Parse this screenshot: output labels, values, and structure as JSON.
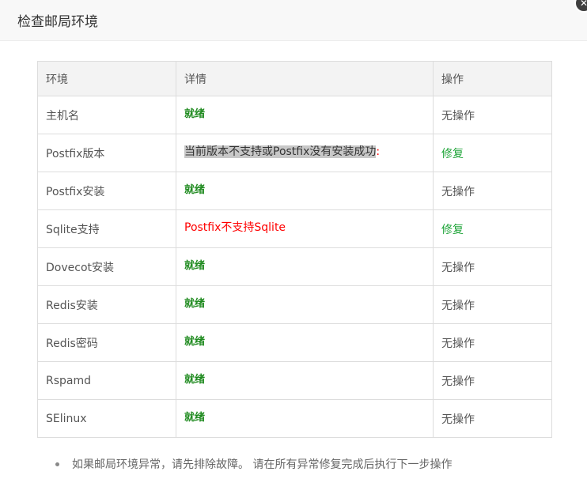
{
  "dialog": {
    "title": "检查邮局环境",
    "close_symbol": "✕"
  },
  "table": {
    "headers": {
      "env": "环境",
      "detail": "详情",
      "action": "操作"
    },
    "rows": [
      {
        "env": "主机名",
        "detail": "就绪",
        "action": "无操作"
      },
      {
        "env": "Postfix版本",
        "detail": "当前版本不支持或Postfix没有安装成功",
        "detail_suffix": ":",
        "action": "修复"
      },
      {
        "env": "Postfix安装",
        "detail": "就绪",
        "action": "无操作"
      },
      {
        "env": "Sqlite支持",
        "detail": "Postfix不支持Sqlite",
        "action": "修复"
      },
      {
        "env": "Dovecot安装",
        "detail": "就绪",
        "action": "无操作"
      },
      {
        "env": "Redis安装",
        "detail": "就绪",
        "action": "无操作"
      },
      {
        "env": "Redis密码",
        "detail": "就绪",
        "action": "无操作"
      },
      {
        "env": "Rspamd",
        "detail": "就绪",
        "action": "无操作"
      },
      {
        "env": "SElinux",
        "detail": "就绪",
        "action": "无操作"
      }
    ]
  },
  "notes": [
    "如果邮局环境异常，请先排除故障。 请在所有异常修复完成后执行下一步操作"
  ],
  "colors": {
    "ready": "#1e8a1e",
    "error": "#ff0000",
    "fix_link": "#20a53a"
  }
}
